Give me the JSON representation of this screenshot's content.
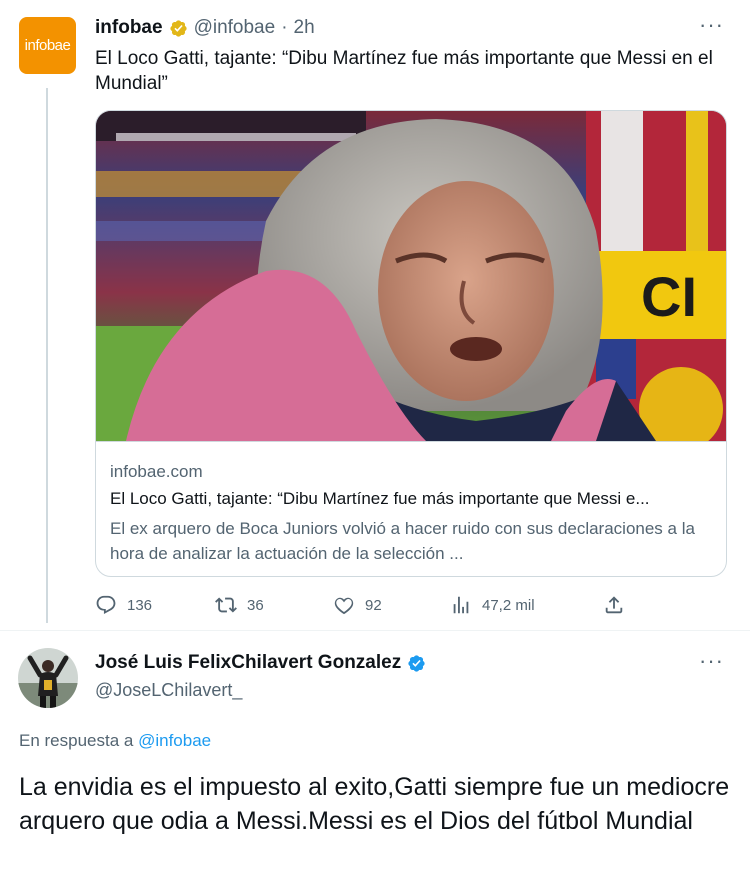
{
  "tweet": {
    "author_name": "infobae",
    "avatar_text": "infobae",
    "handle": "@infobae",
    "separator": "·",
    "time": "2h",
    "more": "···",
    "text": "El Loco Gatti, tajante: “Dibu Martínez fue más importante que Messi en el Mundial”",
    "card": {
      "domain": "infobae.com",
      "title": "El Loco Gatti, tajante: “Dibu Martínez fue más importante que Messi e...",
      "description": "El ex arquero de Boca Juniors volvió a hacer ruido con sus declaraciones a la hora de analizar la actuación de la selección ...",
      "image_letters": "CI"
    },
    "actions": {
      "replies": "136",
      "retweets": "36",
      "likes": "92",
      "views": "47,2 mil"
    }
  },
  "reply": {
    "author_name": "José Luis FelixChilavert Gonzalez",
    "handle": "@JoseLChilavert_",
    "more": "···",
    "reply_prefix": "En respuesta a",
    "reply_mention": "@infobae",
    "text": "La envidia es el impuesto al exito,Gatti siempre fue un mediocre arquero que odia a Messi.Messi es el Dios del fútbol Mundial"
  },
  "colors": {
    "brand_orange": "#f39200",
    "verified_blue": "#1d9bf0",
    "verified_gold": "#e2b719",
    "secondary_text": "#536471"
  }
}
